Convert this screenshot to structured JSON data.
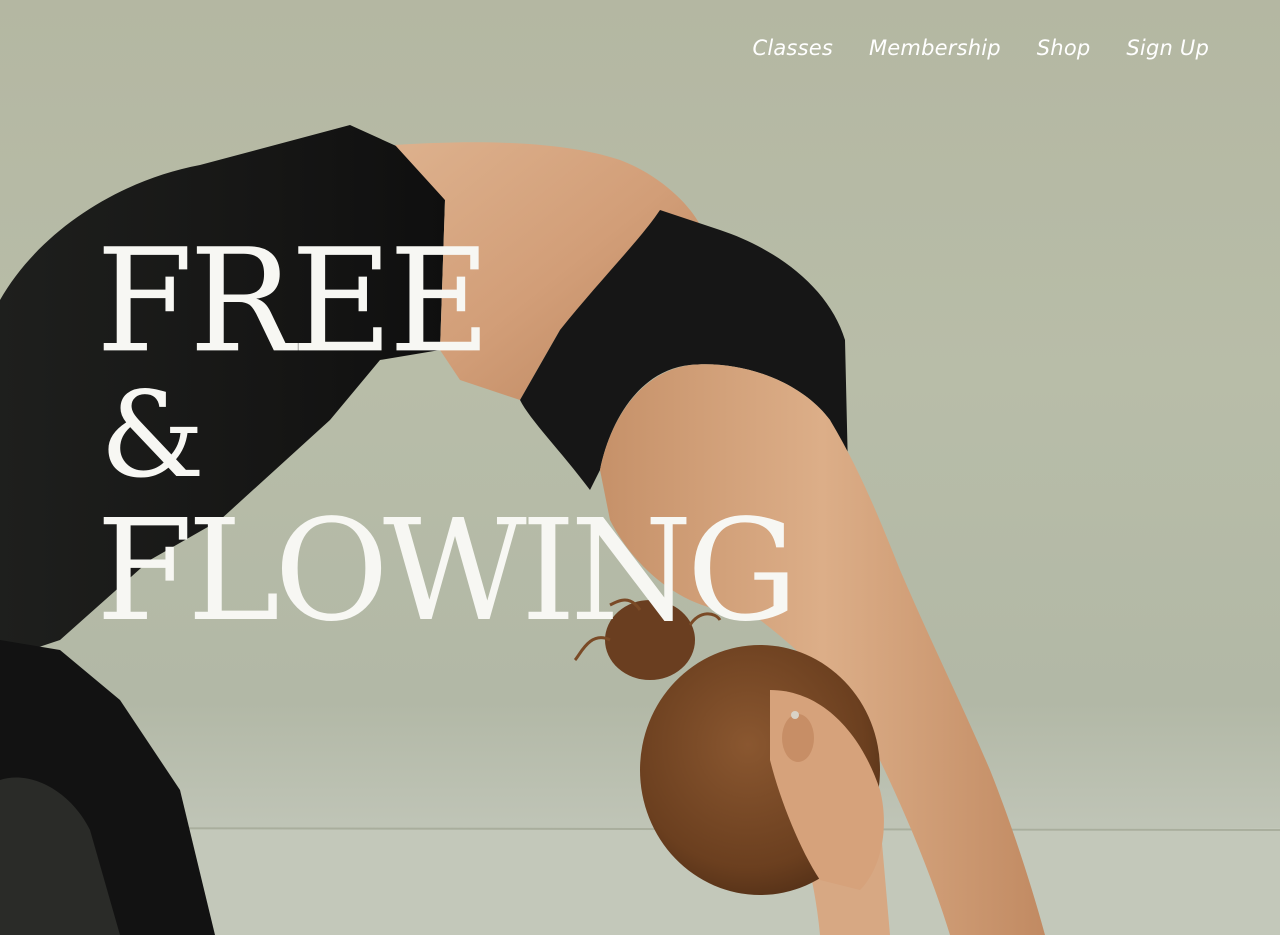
{
  "nav": {
    "items": [
      {
        "label": "Classes"
      },
      {
        "label": "Membership"
      },
      {
        "label": "Shop"
      },
      {
        "label": "Sign Up"
      }
    ]
  },
  "hero": {
    "headline_line1": "FREE",
    "headline_line2": "&",
    "headline_line3": "FLOWING",
    "image_subject": "woman in black sportswear doing a backbend yoga pose"
  },
  "colors": {
    "background": "#b6bba6",
    "text": "#ffffff",
    "apparel": "#141414",
    "skin": "#d1a27d",
    "hair": "#7a4a26"
  }
}
